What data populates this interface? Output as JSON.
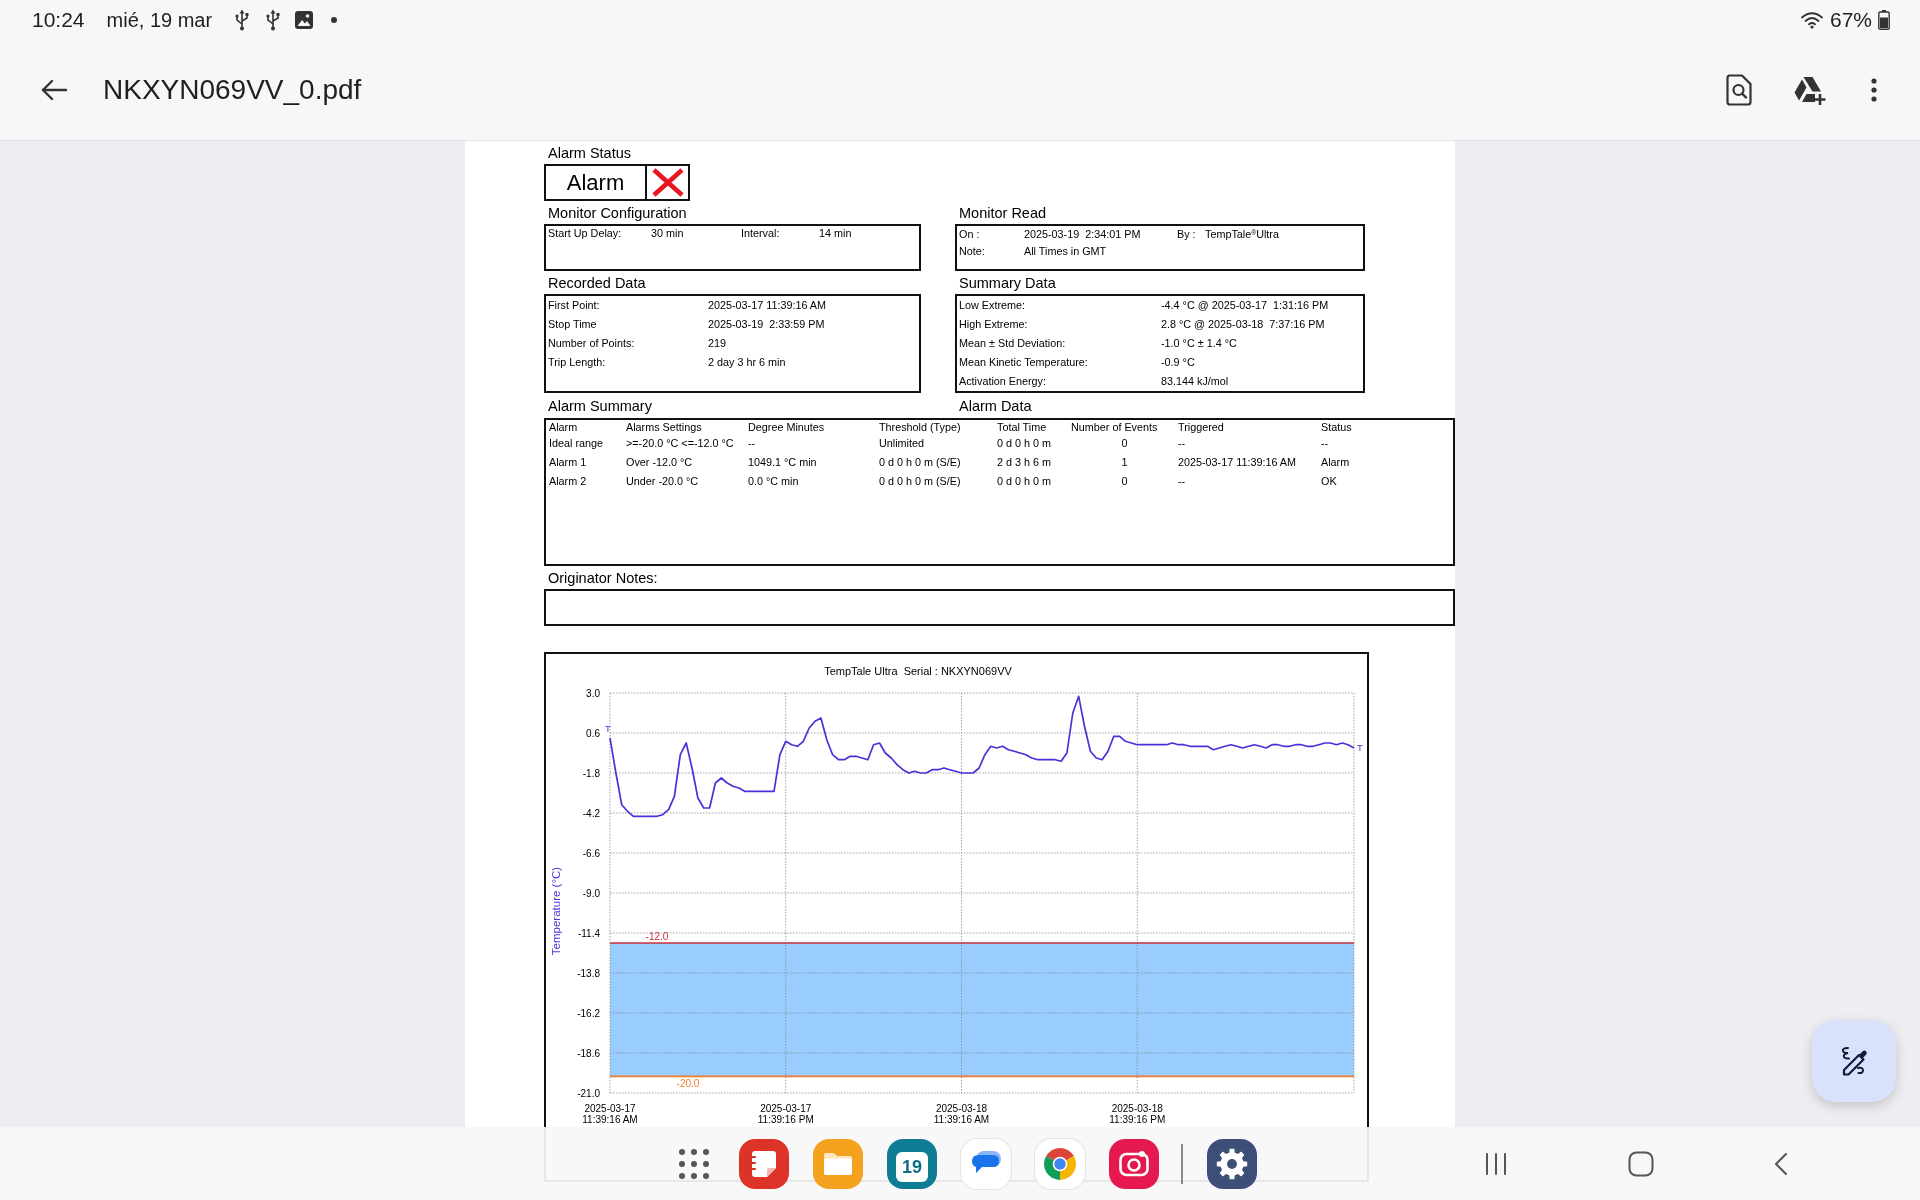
{
  "status_bar": {
    "time": "10:24",
    "date": "mié, 19 mar",
    "battery": "67%"
  },
  "app_bar": {
    "title": "NKXYN069VV_0.pdf"
  },
  "document": {
    "alarm_status": {
      "heading": "Alarm Status",
      "value": "Alarm",
      "alarm": true
    },
    "panels": [
      {
        "kind": "monitor_configuration",
        "heading": "Monitor Configuration",
        "rows": [
          {
            "fields": [
              {
                "label": "Start Up Delay:",
                "value": "30 min"
              },
              {
                "label": "Interval:",
                "value": "14 min"
              }
            ]
          }
        ]
      },
      {
        "kind": "monitor_read",
        "heading": "Monitor Read",
        "rows": [
          {
            "fields": [
              {
                "label": "On :",
                "value": "2025-03-19  2:34:01 PM"
              },
              {
                "label": "By :",
                "value": "TempTale$^{®}$Ultra"
              }
            ]
          },
          {
            "fields": [
              {
                "label": "Note:",
                "value": "All Times in GMT"
              }
            ]
          }
        ]
      },
      {
        "kind": "recorded_data",
        "heading": "Recorded Data",
        "rows": [
          {
            "fields": [
              {
                "label": "First Point:",
                "value": "2025-03-17 11:39:16 AM"
              }
            ]
          },
          {
            "fields": [
              {
                "label": "Stop Time",
                "value": "2025-03-19  2:33:59 PM"
              }
            ]
          },
          {
            "fields": [
              {
                "label": "Number of Points:",
                "value": "219"
              }
            ]
          },
          {
            "fields": [
              {
                "label": "Trip Length:",
                "value": "2 day 3 hr 6 min"
              }
            ]
          }
        ]
      },
      {
        "kind": "summary_data",
        "heading": "Summary Data",
        "rows": [
          {
            "fields": [
              {
                "label": "Low Extreme:",
                "value": "-4.4 °C @ 2025-03-17  1:31:16 PM"
              }
            ]
          },
          {
            "fields": [
              {
                "label": "High Extreme:",
                "value": "2.8 °C @ 2025-03-18  7:37:16 PM"
              }
            ]
          },
          {
            "fields": [
              {
                "label": "Mean ± Std Deviation:",
                "value": "-1.0 °C ± 1.4 °C"
              }
            ]
          },
          {
            "fields": [
              {
                "label": "Mean Kinetic Temperature:",
                "value": "-0.9 °C"
              }
            ]
          },
          {
            "fields": [
              {
                "label": "Activation Energy:",
                "value": "83.144 kJ/mol"
              }
            ]
          }
        ]
      }
    ],
    "alarm_table": {
      "headings": [
        "Alarm Summary",
        "Alarm Data"
      ],
      "columns": [
        "Alarm",
        "Alarms Settings",
        "Degree Minutes",
        "Threshold (Type)",
        "Total Time",
        "Number of Events",
        "Triggered",
        "Status"
      ],
      "rows": [
        {
          "cells": [
            "Ideal range",
            ">=-20.0 °C <=-12.0 °C",
            "--",
            "Unlimited",
            "0 d 0 h 0 m",
            "0",
            "--",
            "--"
          ]
        },
        {
          "cells": [
            "Alarm 1",
            "Over -12.0 °C",
            "1049.1 °C min",
            "0 d 0 h 0 m (S/E)",
            "2 d 3 h 6 m",
            "1",
            "2025-03-17 11:39:16 AM",
            "Alarm"
          ]
        },
        {
          "cells": [
            "Alarm 2",
            "Under -20.0 °C",
            "0.0 °C min",
            "0 d 0 h 0 m (S/E)",
            "0 d 0 h 0 m",
            "0",
            "--",
            "OK"
          ]
        }
      ]
    },
    "originator_notes": {
      "heading": "Originator Notes:"
    },
    "chart": {
      "trip_markers": [
        {
          "text": "T"
        },
        {
          "text": "T"
        }
      ],
      "chart_data": {
        "type": "line",
        "title": "TempTale Ultra  Serial : NKXYN069VV",
        "ylabel": "Temperature (°C)",
        "grid": true,
        "categories": [
          "2025-03-17\n11:39:16 AM",
          null,
          null,
          null,
          null,
          null,
          null,
          null,
          null,
          null,
          null,
          null,
          null,
          null,
          null,
          null,
          null,
          null,
          null,
          null,
          null,
          null,
          null,
          null,
          null,
          null,
          null,
          null,
          null,
          null,
          "2025-03-17\n11:39:16 PM",
          null,
          null,
          null,
          null,
          null,
          null,
          null,
          null,
          null,
          null,
          null,
          null,
          null,
          null,
          null,
          null,
          null,
          null,
          null,
          null,
          null,
          null,
          null,
          null,
          null,
          null,
          null,
          null,
          null,
          "2025-03-18\n11:39:16 AM",
          null,
          null,
          null,
          null,
          null,
          null,
          null,
          null,
          null,
          null,
          null,
          null,
          null,
          null,
          null,
          null,
          null,
          null,
          null,
          null,
          null,
          null,
          null,
          null,
          null,
          null,
          null,
          null,
          null,
          "2025-03-18\n11:39:16 PM",
          null,
          null,
          null,
          null,
          null,
          null,
          null,
          null,
          null,
          null,
          null,
          null,
          null,
          null,
          null,
          null,
          null,
          null,
          null,
          null,
          null,
          null,
          null,
          null,
          null,
          null,
          null,
          null,
          null,
          null,
          null,
          null,
          null,
          null,
          null,
          null,
          null
        ],
        "values": [
          0.3,
          -1.8,
          -3.7,
          -4.1,
          -4.4,
          -4.4,
          -4.4,
          -4.4,
          -4.4,
          -4.3,
          -4.0,
          -3.2,
          -0.7,
          0.0,
          -1.5,
          -3.3,
          -3.9,
          -3.9,
          -2.4,
          -2.1,
          -2.4,
          -2.6,
          -2.7,
          -2.9,
          -2.9,
          -2.9,
          -2.9,
          -2.9,
          -2.9,
          -0.7,
          0.1,
          -0.1,
          -0.2,
          0.1,
          0.9,
          1.3,
          1.5,
          0.2,
          -0.7,
          -1.0,
          -1.0,
          -0.8,
          -0.8,
          -0.9,
          -1.0,
          -0.1,
          0.0,
          -0.6,
          -0.9,
          -1.3,
          -1.6,
          -1.8,
          -1.7,
          -1.8,
          -1.8,
          -1.6,
          -1.6,
          -1.5,
          -1.6,
          -1.7,
          -1.8,
          -1.8,
          -1.8,
          -1.5,
          -0.7,
          -0.2,
          -0.3,
          -0.2,
          -0.4,
          -0.5,
          -0.6,
          -0.7,
          -0.9,
          -1.0,
          -1.0,
          -1.0,
          -1.0,
          -1.1,
          -0.6,
          1.8,
          2.8,
          1.0,
          -0.5,
          -0.9,
          -1.0,
          -0.5,
          0.4,
          0.4,
          0.1,
          0.0,
          -0.1,
          -0.1,
          -0.1,
          -0.1,
          -0.1,
          -0.1,
          0.0,
          -0.1,
          -0.1,
          -0.2,
          -0.2,
          -0.2,
          -0.2,
          -0.4,
          -0.3,
          -0.2,
          -0.1,
          -0.2,
          -0.3,
          -0.2,
          -0.1,
          -0.2,
          -0.3,
          -0.1,
          -0.1,
          -0.2,
          -0.2,
          -0.1,
          -0.1,
          -0.2,
          -0.2,
          -0.1,
          0.0,
          0.0,
          -0.1,
          0.0,
          -0.1,
          -0.3
        ],
        "ylim": [
          -21,
          3
        ],
        "yticks": [
          {
            "value": 3,
            "label": "3.0"
          },
          {
            "value": 0.6,
            "label": "0.6"
          },
          {
            "value": -1.8,
            "label": "-1.8"
          },
          {
            "value": -4.2,
            "label": "-4.2"
          },
          {
            "value": -6.6,
            "label": "-6.6"
          },
          {
            "value": -9,
            "label": "-9.0"
          },
          {
            "value": -11.4,
            "label": "-11.4"
          },
          {
            "value": -13.8,
            "label": "-13.8"
          },
          {
            "value": -16.2,
            "label": "-16.2"
          },
          {
            "value": -18.6,
            "label": "-18.6"
          },
          {
            "value": -21,
            "label": "-21.0"
          }
        ],
        "bands": [
          {
            "axis": "y",
            "from": -20,
            "to": -12,
            "color": "#99ccff"
          }
        ],
        "ref_lines": [
          {
            "axis": "y",
            "value": -12,
            "label": "-12.0",
            "color": "#c8323c"
          },
          {
            "axis": "y",
            "value": -20,
            "label": "-20.0",
            "color": "#f07d2e"
          }
        ]
      }
    }
  },
  "dock": {
    "calendar_day": "19"
  }
}
